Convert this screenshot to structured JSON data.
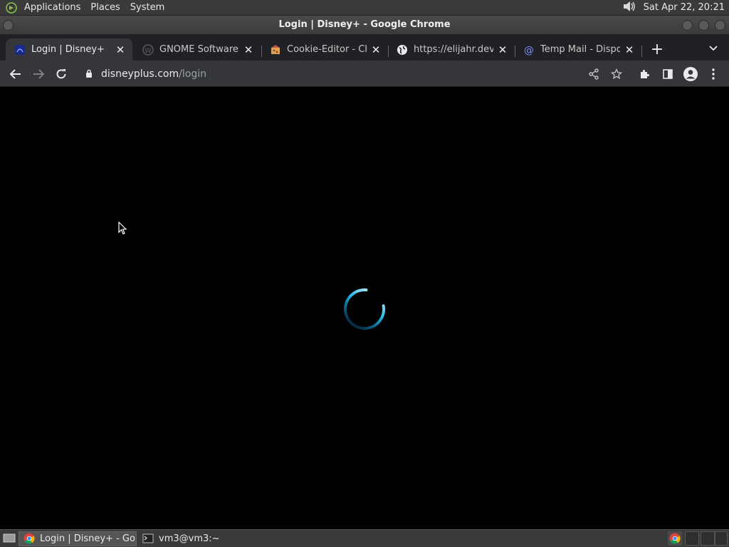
{
  "top_panel": {
    "menus": [
      "Applications",
      "Places",
      "System"
    ],
    "clock": "Sat Apr 22, 20:21"
  },
  "window": {
    "title": "Login | Disney+ - Google Chrome"
  },
  "tabs": [
    {
      "title": "Login | Disney+",
      "icon": "disney-icon",
      "active": true
    },
    {
      "title": "GNOME Software -",
      "icon": "wordpress-icon",
      "active": false
    },
    {
      "title": "Cookie-Editor - Chro",
      "icon": "cookie-icon",
      "active": false
    },
    {
      "title": "https://elijahr.dev/p",
      "icon": "globe-icon",
      "active": false
    },
    {
      "title": "Temp Mail - Dispos",
      "icon": "at-sign-icon",
      "active": false
    }
  ],
  "omnibox": {
    "host": "disneyplus.com",
    "path": "/login"
  },
  "taskbar": {
    "items": [
      {
        "label": "Login | Disney+ - Go...",
        "icon": "chrome-icon",
        "active": true
      },
      {
        "label": "vm3@vm3:~",
        "icon": "terminal-icon",
        "active": false
      }
    ]
  },
  "colors": {
    "spinner": "#1fb6e8",
    "page_background": "#000000"
  }
}
